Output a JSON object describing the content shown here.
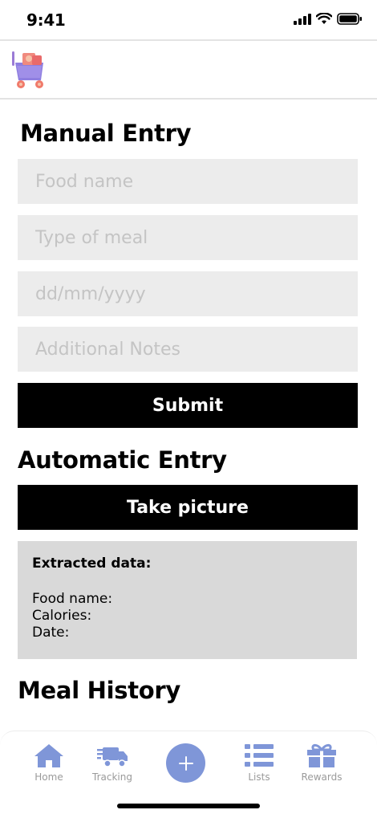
{
  "status_bar": {
    "time": "9:41"
  },
  "manual_entry": {
    "title": "Manual Entry",
    "food_name_placeholder": "Food name",
    "meal_type_placeholder": "Type of meal",
    "date_placeholder": "dd/mm/yyyy",
    "notes_placeholder": "Additional Notes",
    "submit_label": "Submit"
  },
  "automatic_entry": {
    "title": "Automatic Entry",
    "take_picture_label": "Take picture",
    "extracted_title": "Extracted data:",
    "food_name_label": "Food name:",
    "calories_label": "Calories:",
    "date_label": "Date:"
  },
  "meal_history": {
    "title": "Meal History"
  },
  "nav": {
    "items": [
      {
        "label": "Home",
        "icon": "home-icon"
      },
      {
        "label": "Tracking",
        "icon": "truck-icon"
      },
      {
        "label": "",
        "icon": "plus-icon"
      },
      {
        "label": "Lists",
        "icon": "list-icon"
      },
      {
        "label": "Rewards",
        "icon": "gift-icon"
      }
    ],
    "accent_color": "#7f96d8"
  }
}
